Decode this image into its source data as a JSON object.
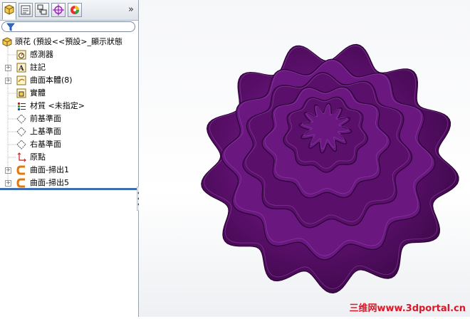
{
  "tree": {
    "root_label": "頭花 (預設<<預設>_顯示狀態",
    "items": [
      {
        "label": "感測器",
        "icon": "sensor-icon",
        "expandable": false
      },
      {
        "label": "註記",
        "icon": "annotation-icon",
        "expandable": true
      },
      {
        "label": "曲面本體(8)",
        "icon": "surface-bodies-icon",
        "expandable": true
      },
      {
        "label": "實體",
        "icon": "solid-bodies-icon",
        "expandable": false
      },
      {
        "label": "材質 <未指定>",
        "icon": "material-icon",
        "expandable": false
      },
      {
        "label": "前基準面",
        "icon": "plane-icon",
        "expandable": false
      },
      {
        "label": "上基準面",
        "icon": "plane-icon",
        "expandable": false
      },
      {
        "label": "右基準面",
        "icon": "plane-icon",
        "expandable": false
      },
      {
        "label": "原點",
        "icon": "origin-icon",
        "expandable": false
      },
      {
        "label": "曲面-掃出1",
        "icon": "swept-surface-icon",
        "expandable": true
      },
      {
        "label": "曲面-掃出5",
        "icon": "swept-surface-icon",
        "expandable": true
      }
    ]
  },
  "tabs": [
    "feature-manager-tab",
    "property-manager-tab",
    "configuration-manager-tab",
    "dimxpert-tab",
    "display-manager-tab"
  ],
  "expander_glyph": "»",
  "watermark": "三维网www.3dportal.cn",
  "colors": {
    "model": "#5a0f6a",
    "accent": "#3c6cb4",
    "watermark": "#d8192a"
  }
}
